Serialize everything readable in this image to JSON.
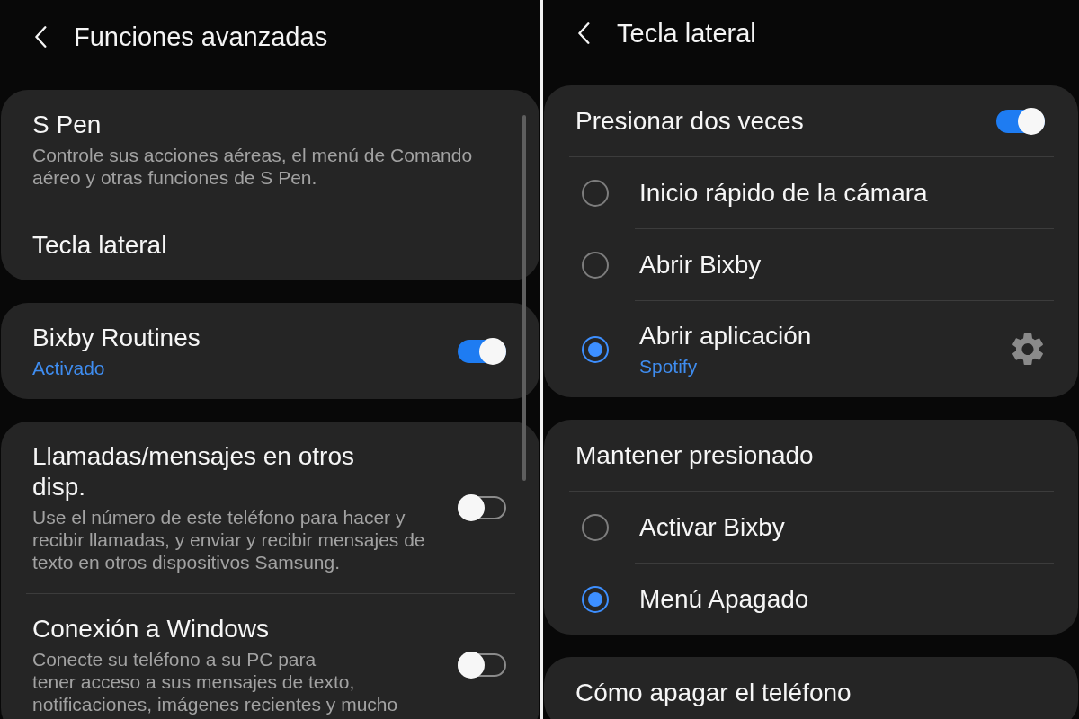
{
  "screens": [
    {
      "header": {
        "title": "Funciones avanzadas"
      },
      "scrollbar": true,
      "cards": [
        {
          "items": [
            {
              "kind": "link",
              "title": "S Pen",
              "description": "Controle sus acciones aéreas, el menú de Comando\naéreo y otras funciones de S Pen."
            },
            {
              "kind": "link",
              "title": "Tecla lateral"
            }
          ]
        },
        {
          "items": [
            {
              "kind": "switch",
              "title": "Bixby Routines",
              "status": "Activado",
              "on": true
            }
          ]
        },
        {
          "items": [
            {
              "kind": "switch",
              "title": "Llamadas/mensajes en otros\ndisp.",
              "description": "Use el número de este teléfono para hacer y\nrecibir llamadas, y enviar y recibir mensajes de\ntexto en otros dispositivos Samsung.",
              "on": false
            },
            {
              "kind": "switch",
              "title": "Conexión a Windows",
              "description": "Conecte su teléfono a su PC para\ntener acceso a sus mensajes de texto,\nnotificaciones, imágenes recientes y mucho",
              "on": false
            }
          ]
        }
      ]
    },
    {
      "header": {
        "title": "Tecla lateral"
      },
      "cards": [
        {
          "items": [
            {
              "kind": "master-switch",
              "title": "Presionar dos veces",
              "on": true
            },
            {
              "kind": "radio",
              "title": "Inicio rápido de la cámara",
              "selected": false
            },
            {
              "kind": "radio",
              "title": "Abrir Bixby",
              "selected": false
            },
            {
              "kind": "radio",
              "title": "Abrir aplicación",
              "status": "Spotify",
              "selected": true,
              "settings_button": true
            }
          ]
        },
        {
          "items": [
            {
              "kind": "heading",
              "title": "Mantener presionado"
            },
            {
              "kind": "radio",
              "title": "Activar Bixby",
              "selected": false
            },
            {
              "kind": "radio",
              "title": "Menú Apagado",
              "selected": true
            }
          ]
        },
        {
          "items": [
            {
              "kind": "link",
              "title": "Cómo apagar el teléfono"
            }
          ]
        }
      ]
    }
  ]
}
